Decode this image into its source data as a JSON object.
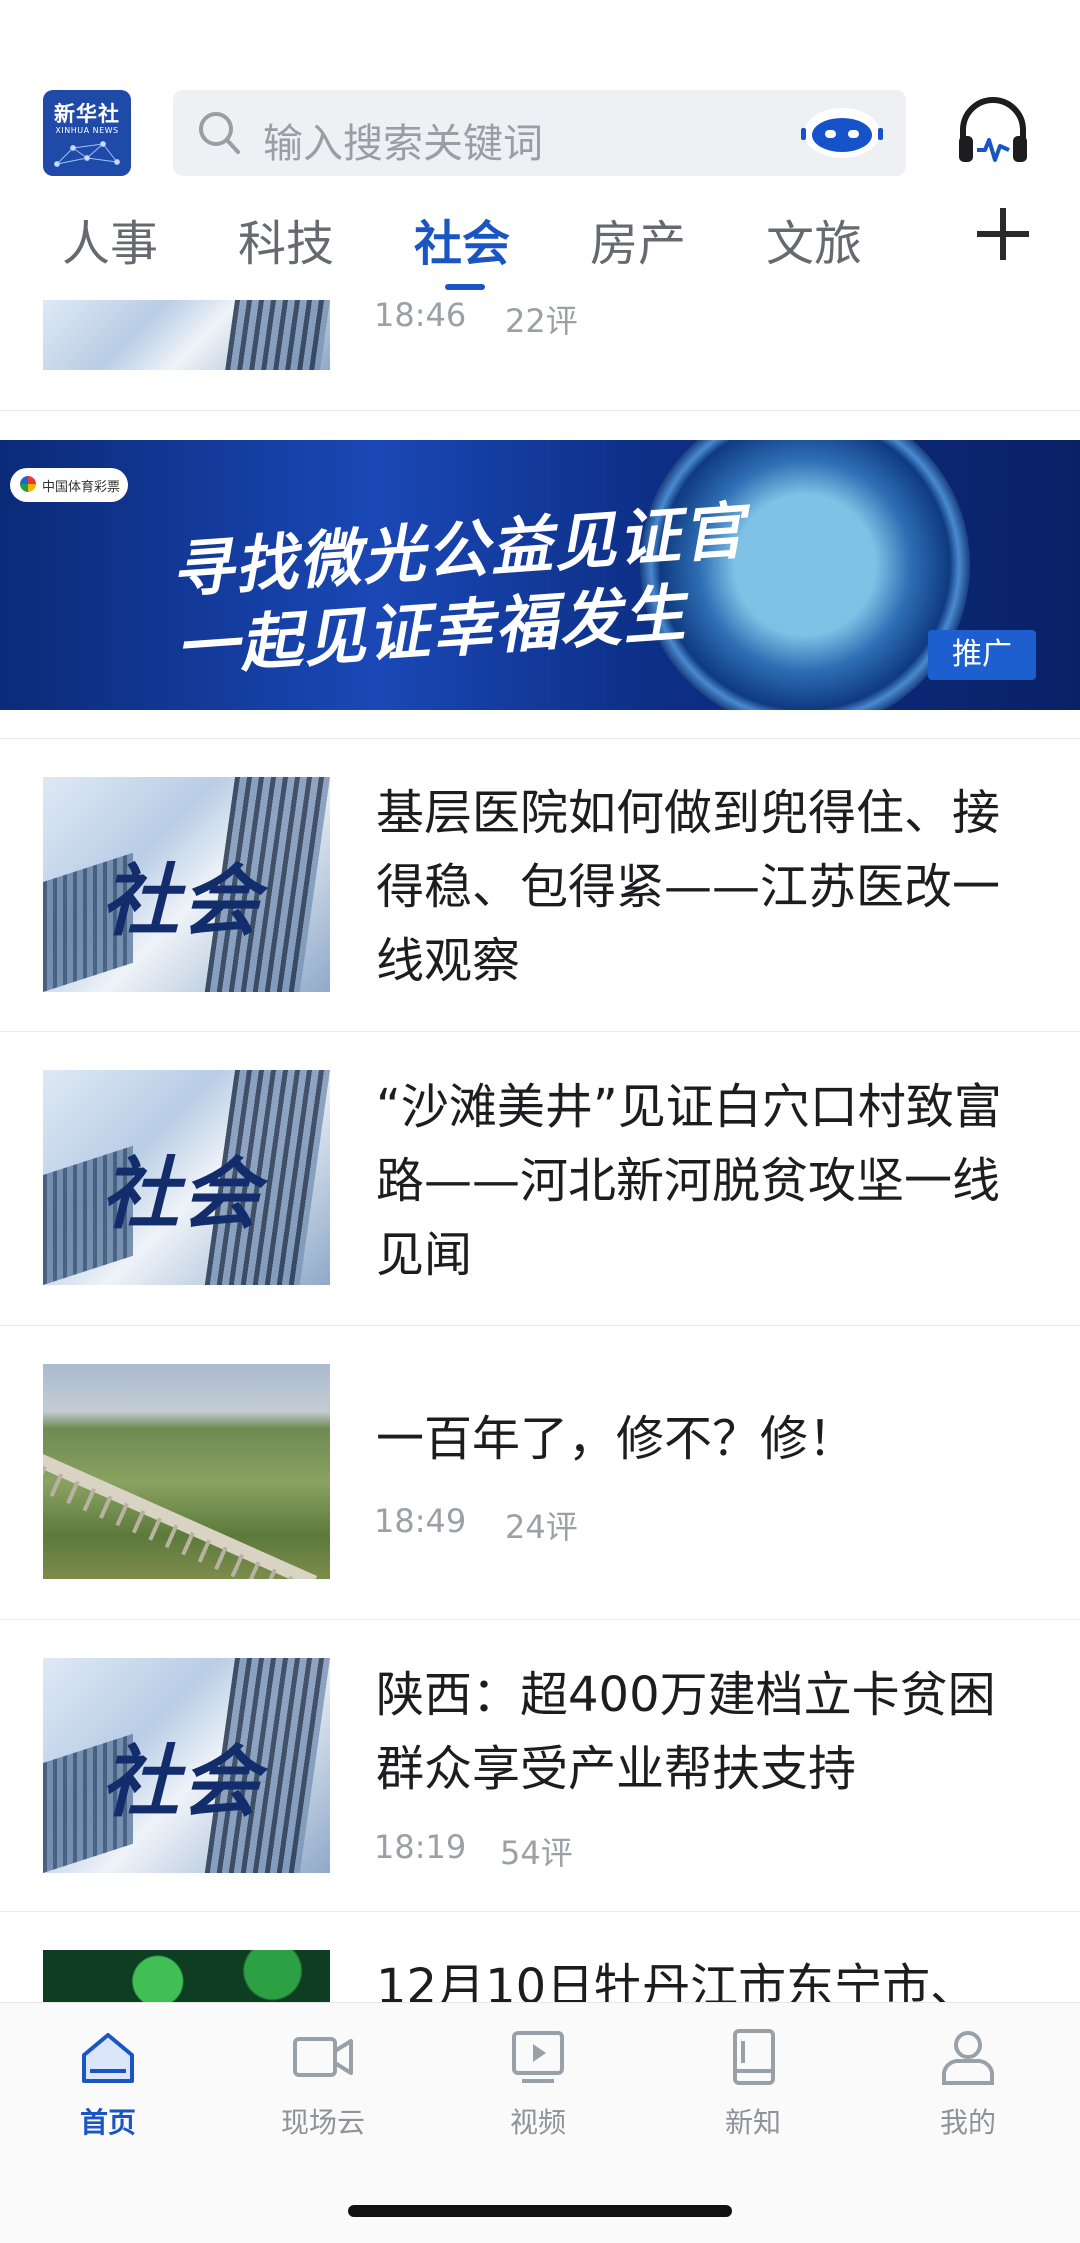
{
  "header": {
    "logo": {
      "cn": "新华社",
      "en": "XINHUA NEWS"
    },
    "search_placeholder": "输入搜索关键词",
    "icons": {
      "search": "magnifier-icon",
      "assistant": "robot-icon",
      "audio": "headphone-icon"
    }
  },
  "tabs": [
    {
      "label": "人事",
      "active": false
    },
    {
      "label": "科技",
      "active": false
    },
    {
      "label": "社会",
      "active": true
    },
    {
      "label": "房产",
      "active": false
    },
    {
      "label": "文旅",
      "active": false
    }
  ],
  "thumb_word": "社会",
  "partial_top": {
    "time": "18:46",
    "comments": "22评"
  },
  "banner": {
    "line1": "寻找微光公益见证官",
    "line2": "一起见证幸福发生",
    "sponsor": "中国体育彩票",
    "ad_label": "推广"
  },
  "articles": [
    {
      "title": "基层医院如何做到兜得住、接得稳、包得紧——江苏医改一线观察",
      "time": "",
      "comments": ""
    },
    {
      "title": "“沙滩美井”见证白穴口村致富路——河北新河脱贫攻坚一线见闻",
      "time": "",
      "comments": ""
    },
    {
      "title": "一百年了，修不？修！",
      "time": "18:49",
      "comments": "24评"
    },
    {
      "title": "陕西：超400万建档立卡贫困群众享受产业帮扶支持",
      "time": "18:19",
      "comments": "54评"
    },
    {
      "title": "12月10日牡丹江市东宁市、",
      "time": "",
      "comments": ""
    }
  ],
  "bottom_nav": [
    {
      "label": "首页",
      "icon": "home-icon",
      "active": true
    },
    {
      "label": "现场云",
      "icon": "video-camera-icon",
      "active": false
    },
    {
      "label": "视频",
      "icon": "play-screen-icon",
      "active": false
    },
    {
      "label": "新知",
      "icon": "book-icon",
      "active": false
    },
    {
      "label": "我的",
      "icon": "user-icon",
      "active": false
    }
  ],
  "colors": {
    "accent": "#1b55c4",
    "text": "#1d1d1f",
    "meta": "#9aa0a6"
  }
}
